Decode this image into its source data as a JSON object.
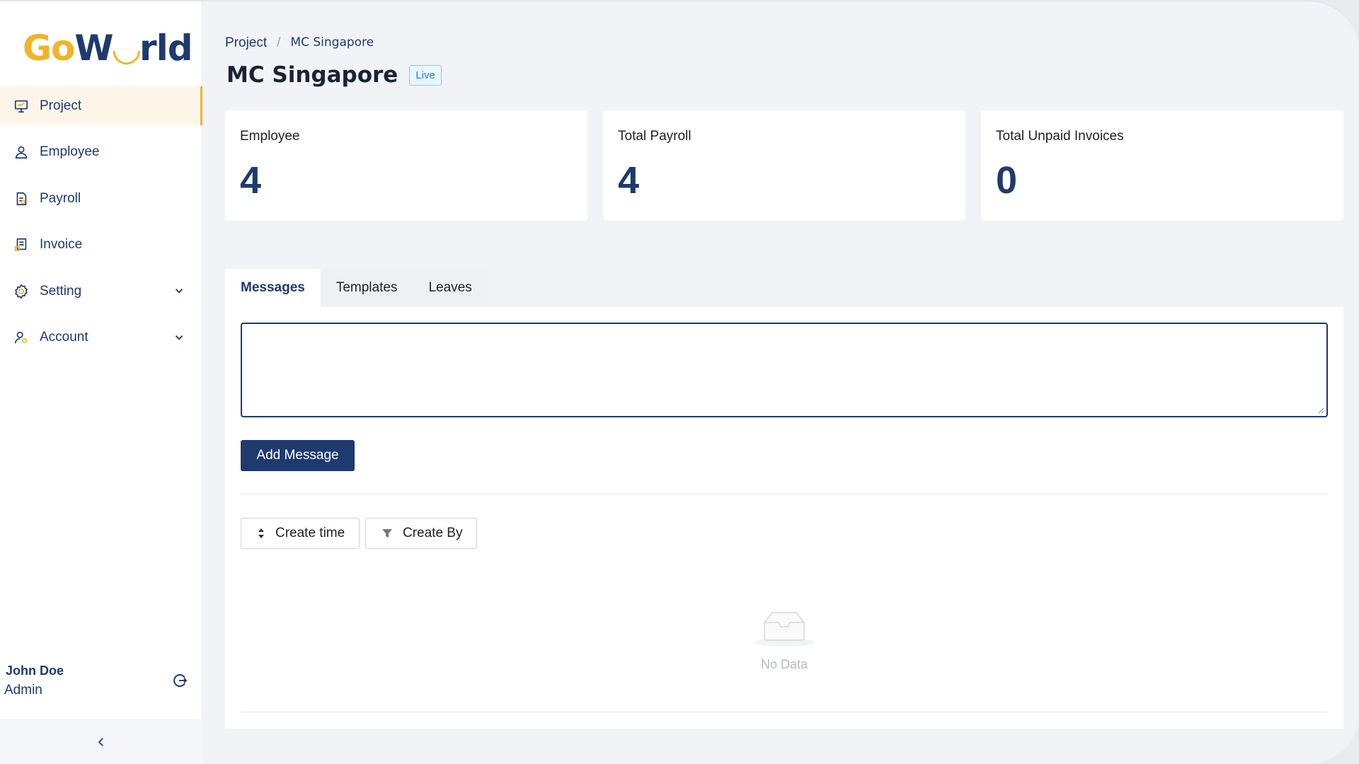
{
  "app": {
    "logo": {
      "go": "Go",
      "w": "W",
      "smile": "◡",
      "rld": "rld"
    }
  },
  "sidebar": {
    "items": [
      {
        "label": "Project",
        "icon": "presentation-icon",
        "active": true
      },
      {
        "label": "Employee",
        "icon": "user-icon",
        "active": false
      },
      {
        "label": "Payroll",
        "icon": "document-icon",
        "active": false
      },
      {
        "label": "Invoice",
        "icon": "invoice-icon",
        "active": false
      },
      {
        "label": "Setting",
        "icon": "gear-icon",
        "active": false,
        "expandable": true
      },
      {
        "label": "Account",
        "icon": "account-icon",
        "active": false,
        "expandable": true
      }
    ],
    "user": {
      "name": "John Doe",
      "role": "Admin"
    }
  },
  "breadcrumb": {
    "parent": "Project",
    "separator": "/",
    "current": "MC Singapore"
  },
  "page": {
    "title": "MC Singapore",
    "status": "Live"
  },
  "cards": [
    {
      "label": "Employee",
      "value": "4"
    },
    {
      "label": "Total Payroll",
      "value": "4"
    },
    {
      "label": "Total Unpaid Invoices",
      "value": "0"
    }
  ],
  "tabs": [
    {
      "label": "Messages",
      "active": true
    },
    {
      "label": "Templates",
      "active": false
    },
    {
      "label": "Leaves",
      "active": false
    }
  ],
  "messages": {
    "input_value": "",
    "add_label": "Add Message",
    "sort_label": "Create time",
    "filter_label": "Create By",
    "empty_text": "No Data"
  },
  "colors": {
    "brand_primary": "#1e3a6e",
    "brand_accent": "#f2b32a",
    "live_badge": "#1b82d6"
  }
}
